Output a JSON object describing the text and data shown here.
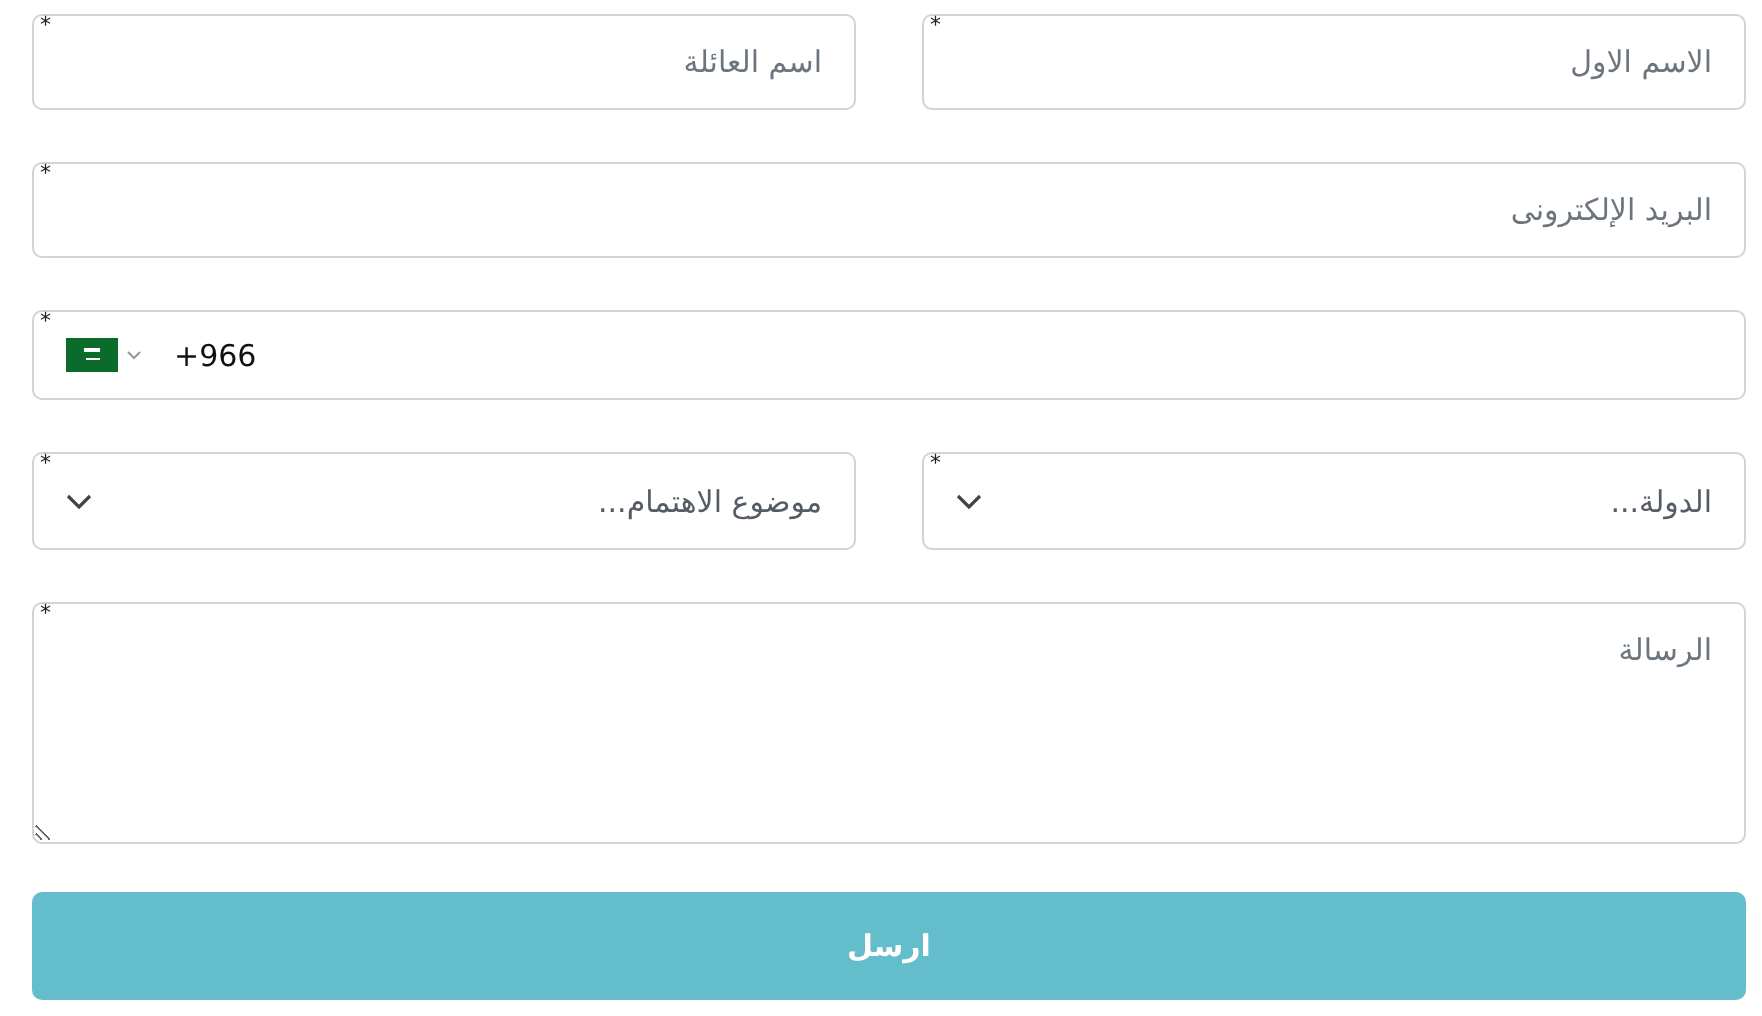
{
  "rows": [
    {
      "fields": [
        {
          "kind": "text",
          "placeholder": "الاسم الاول",
          "marker": "*"
        },
        {
          "kind": "text",
          "placeholder": "اسم العائلة",
          "marker": "*"
        }
      ]
    },
    {
      "fields": [
        {
          "kind": "text",
          "placeholder": "البريد الإلكترونى",
          "marker": "*"
        }
      ]
    },
    {
      "fields": [
        {
          "kind": "phone",
          "value": "+966",
          "marker": "*"
        }
      ]
    },
    {
      "fields": [
        {
          "kind": "select",
          "placeholder": "الدولة...",
          "marker": "*"
        },
        {
          "kind": "select",
          "placeholder": "موضوع الاهتمام...",
          "marker": "*"
        }
      ]
    },
    {
      "fields": [
        {
          "kind": "textarea",
          "placeholder": "الرسالة",
          "marker": "*"
        }
      ]
    }
  ],
  "submit": {
    "label": "ارسل"
  }
}
